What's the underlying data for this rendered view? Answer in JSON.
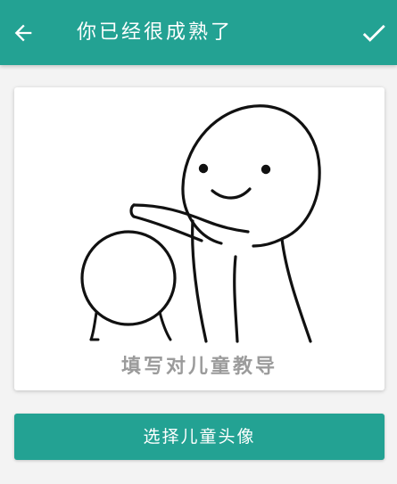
{
  "app_bar": {
    "title": "你已经很成熟了",
    "back_icon": "arrow-left-icon",
    "confirm_icon": "check-icon",
    "color": "#23a293"
  },
  "avatar_card": {
    "caption": "填写对儿童教导"
  },
  "select_button": {
    "label": "选择儿童头像"
  }
}
